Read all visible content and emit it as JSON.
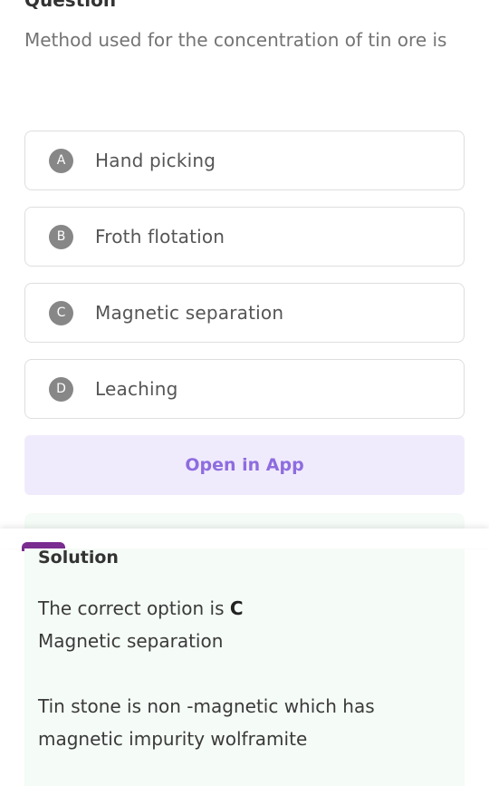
{
  "question": {
    "heading": "Question",
    "text": "Method used for the concentration of tin ore is"
  },
  "options": [
    {
      "letter": "A",
      "label": "Hand picking"
    },
    {
      "letter": "B",
      "label": "Froth flotation"
    },
    {
      "letter": "C",
      "label": "Magnetic separation"
    },
    {
      "letter": "D",
      "label": "Leaching"
    }
  ],
  "open_app_label": "Open in App",
  "solution": {
    "heading": "Solution",
    "correct_prefix": "The correct option is ",
    "correct_letter": "C",
    "correct_text": "Magnetic separation",
    "explanation": "Tin stone is non -magnetic which has magnetic impurity wolframite"
  },
  "colors": {
    "accent": "#8e6ce0",
    "open_app_bg": "#f0ebfc",
    "solution_bg": "#f5fbf6",
    "option_letter_bg": "#878787",
    "logo": "#7a2c8f"
  }
}
